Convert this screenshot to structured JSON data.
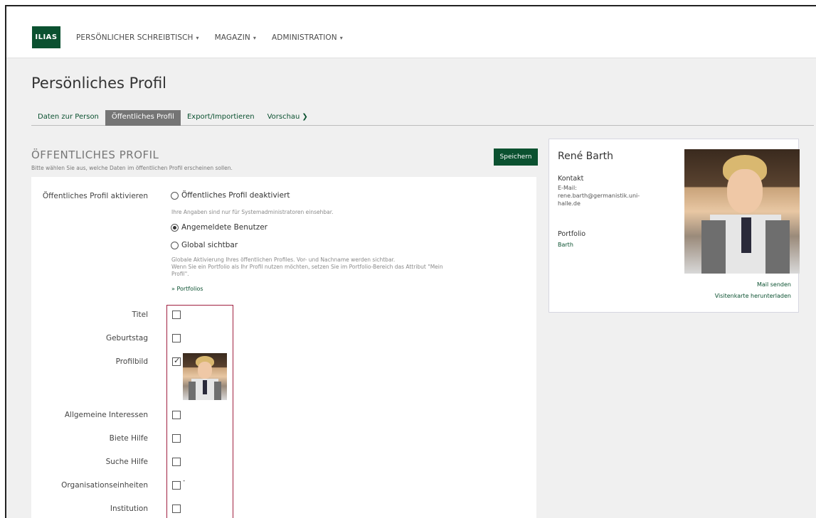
{
  "app": {
    "logo_text": "ILIAS"
  },
  "nav": {
    "items": [
      {
        "label": "PERSÖNLICHER SCHREIBTISCH"
      },
      {
        "label": "MAGAZIN"
      },
      {
        "label": "ADMINISTRATION"
      }
    ]
  },
  "page": {
    "title": "Persönliches Profil"
  },
  "tabs": [
    {
      "label": "Daten zur Person",
      "active": false
    },
    {
      "label": "Öffentliches Profil",
      "active": true
    },
    {
      "label": "Export/Importieren",
      "active": false
    },
    {
      "label": "Vorschau",
      "active": false
    }
  ],
  "form": {
    "heading": "ÖFFENTLICHES PROFIL",
    "subheading": "Bitte wählen Sie aus, welche Daten im öffentlichen Profil erscheinen sollen.",
    "save_label": "Speichern",
    "activate_label": "Öffentliches Profil aktivieren",
    "options": [
      {
        "label": "Öffentliches Profil deaktiviert",
        "selected": false,
        "hint": "Ihre Angaben sind nur für Systemadministratoren einsehbar."
      },
      {
        "label": "Angemeldete Benutzer",
        "selected": true,
        "hint": ""
      },
      {
        "label": "Global sichtbar",
        "selected": false,
        "hint": "Globale Aktivierung Ihres öffentlichen Profiles. Vor- und Nachname werden sichtbar.",
        "hint2": "Wenn Sie ein Portfolio als Ihr Profil nutzen möchten, setzen Sie im Portfolio-Bereich das Attribut \"Mein",
        "hint3": "Profil\"."
      }
    ],
    "portfolios_link": "» Portfolios",
    "fields": [
      {
        "label": "Titel",
        "checked": false
      },
      {
        "label": "Geburtstag",
        "checked": false
      },
      {
        "label": "Profilbild",
        "checked": true
      },
      {
        "label": "Allgemeine Interessen",
        "checked": false
      },
      {
        "label": "Biete Hilfe",
        "checked": false
      },
      {
        "label": "Suche Hilfe",
        "checked": false
      },
      {
        "label": "Organisationseinheiten",
        "checked": false,
        "suffix": "-"
      },
      {
        "label": "Institution",
        "checked": false
      }
    ]
  },
  "card": {
    "name": "René Barth",
    "contact_label": "Kontakt",
    "email_label": "E-Mail:",
    "email_line1": "rene.barth@germanistik.uni-",
    "email_line2": "halle.de",
    "portfolio_label": "Portfolio",
    "portfolio_link": "Barth",
    "mail_link": "Mail senden",
    "vcard_link": "Visitenkarte herunterladen"
  },
  "colors": {
    "brand": "#0b5130",
    "highlight_border": "#a02040"
  }
}
